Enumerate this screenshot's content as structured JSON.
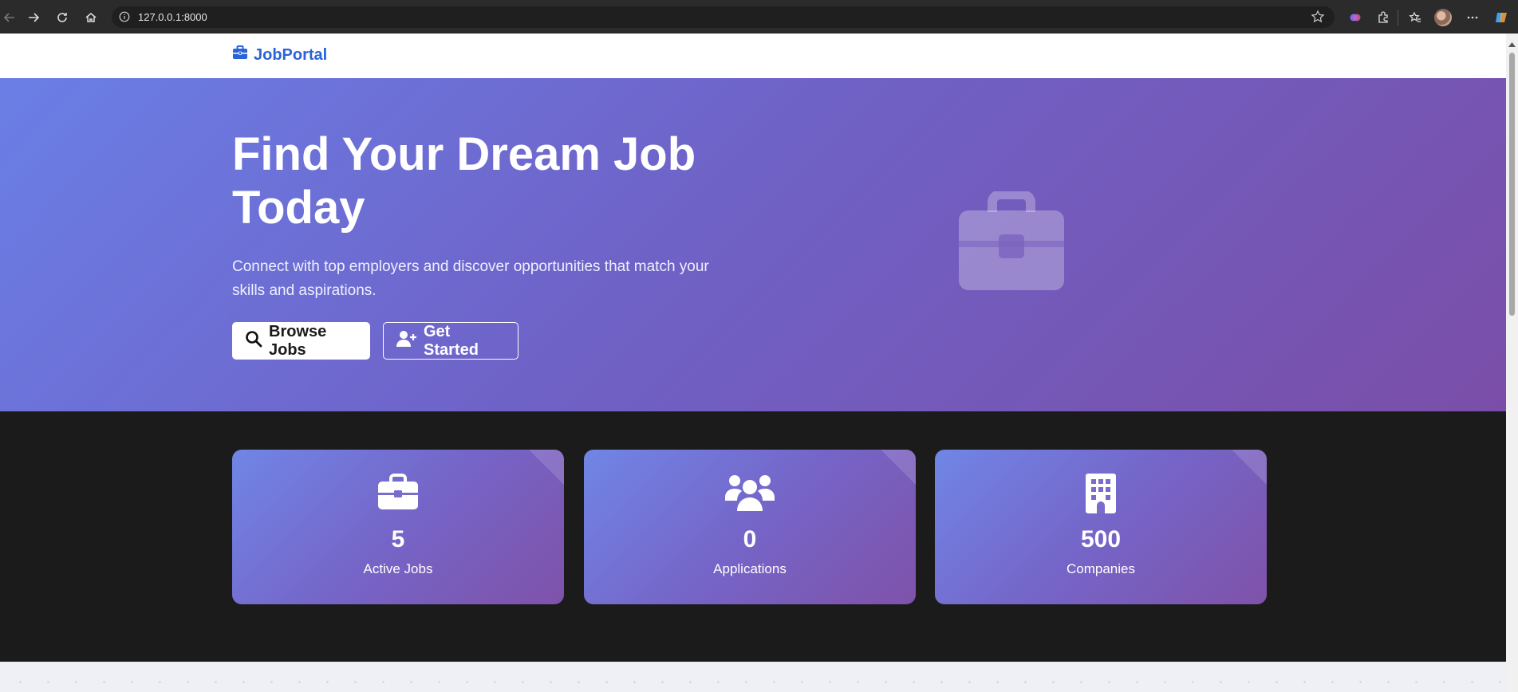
{
  "browser": {
    "url": "127.0.0.1:8000"
  },
  "navbar": {
    "brand": "JobPortal",
    "brand_icon": "briefcase-icon"
  },
  "hero": {
    "title": "Find Your Dream Job Today",
    "subtitle": "Connect with top employers and discover opportunities that match your skills and aspirations.",
    "browse_label": "Browse Jobs",
    "get_started_label": "Get Started",
    "illustration_icon": "briefcase-icon"
  },
  "stats": [
    {
      "icon": "briefcase-icon",
      "value": "5",
      "label": "Active Jobs"
    },
    {
      "icon": "users-icon",
      "value": "0",
      "label": "Applications"
    },
    {
      "icon": "building-icon",
      "value": "500",
      "label": "Companies"
    }
  ],
  "colors": {
    "brand": "#2b63d9",
    "hero_start": "#6a7fe6",
    "hero_end": "#7a4ea8",
    "dark_band": "#1b1b1b"
  }
}
